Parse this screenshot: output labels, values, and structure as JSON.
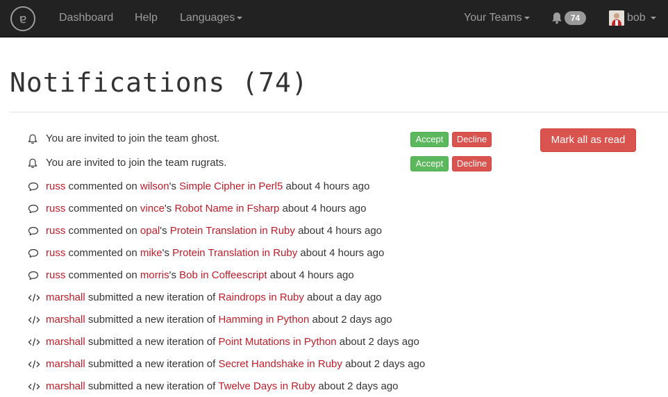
{
  "navbar": {
    "logo_glyph": "ɐ",
    "dashboard": "Dashboard",
    "help": "Help",
    "languages": "Languages",
    "your_teams": "Your Teams",
    "notification_count": "74",
    "username": "bob"
  },
  "page": {
    "title": "Notifications (74)",
    "mark_all_label": "Mark all as read"
  },
  "invites": [
    {
      "text": "You are invited to join the team ghost.",
      "accept": "Accept",
      "decline": "Decline"
    },
    {
      "text": "You are invited to join the team rugrats.",
      "accept": "Accept",
      "decline": "Decline"
    }
  ],
  "comments": [
    {
      "user": "russ",
      "verb": " commented on ",
      "owner": "wilson",
      "possessive": "'s ",
      "exercise": "Simple Cipher in Perl5",
      "time": " about 4 hours ago"
    },
    {
      "user": "russ",
      "verb": " commented on ",
      "owner": "vince",
      "possessive": "'s ",
      "exercise": "Robot Name in Fsharp",
      "time": " about 4 hours ago"
    },
    {
      "user": "russ",
      "verb": " commented on ",
      "owner": "opal",
      "possessive": "'s ",
      "exercise": "Protein Translation in Ruby",
      "time": " about 4 hours ago"
    },
    {
      "user": "russ",
      "verb": " commented on ",
      "owner": "mike",
      "possessive": "'s ",
      "exercise": "Protein Translation in Ruby",
      "time": " about 4 hours ago"
    },
    {
      "user": "russ",
      "verb": " commented on ",
      "owner": "morris",
      "possessive": "'s ",
      "exercise": "Bob in Coffeescript",
      "time": " about 4 hours ago"
    }
  ],
  "iterations": [
    {
      "user": "marshall",
      "verb": " submitted a new iteration of ",
      "exercise": "Raindrops in Ruby",
      "time": " about a day ago"
    },
    {
      "user": "marshall",
      "verb": " submitted a new iteration of ",
      "exercise": "Hamming in Python",
      "time": " about 2 days ago"
    },
    {
      "user": "marshall",
      "verb": " submitted a new iteration of ",
      "exercise": "Point Mutations in Python",
      "time": " about 2 days ago"
    },
    {
      "user": "marshall",
      "verb": " submitted a new iteration of ",
      "exercise": "Secret Handshake in Ruby",
      "time": " about 2 days ago"
    },
    {
      "user": "marshall",
      "verb": " submitted a new iteration of ",
      "exercise": "Twelve Days in Ruby",
      "time": " about 2 days ago"
    }
  ],
  "icons": {
    "invite": "bell-icon",
    "comment": "comment-bubble-icon",
    "iteration": "code-icon"
  },
  "colors": {
    "navbar_bg": "#222222",
    "link": "#c01c28",
    "accept": "#5cb85c",
    "danger": "#d9534f",
    "badge": "#999999"
  }
}
